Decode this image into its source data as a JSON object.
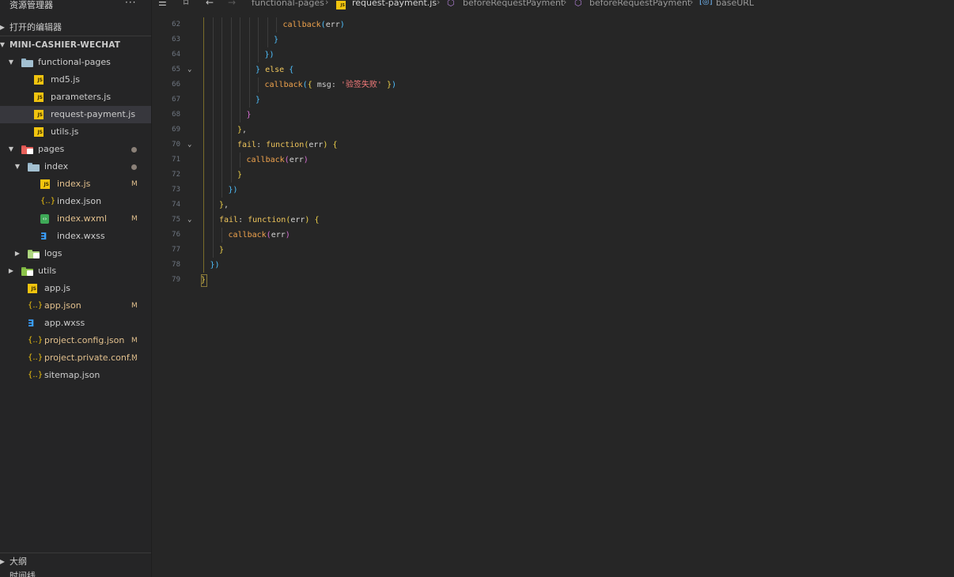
{
  "explorer": {
    "title": "资源管理器",
    "more": "···",
    "open_editors": "打开的编辑器",
    "project": "MINI-CASHIER-WECHAT",
    "outline": "大纲",
    "timeline": "时间线"
  },
  "tree": [
    {
      "label": "functional-pages",
      "type": "folder-blue",
      "indent": 0,
      "expanded": true
    },
    {
      "label": "md5.js",
      "type": "js",
      "indent": 1
    },
    {
      "label": "parameters.js",
      "type": "js",
      "indent": 1
    },
    {
      "label": "request-payment.js",
      "type": "js",
      "indent": 1,
      "selected": true
    },
    {
      "label": "utils.js",
      "type": "js",
      "indent": 1
    },
    {
      "label": "pages",
      "type": "folder-red",
      "indent": 0,
      "expanded": true,
      "dot": true
    },
    {
      "label": "index",
      "type": "folder-blue",
      "indent": 1,
      "expanded": true,
      "dot": true
    },
    {
      "label": "index.js",
      "type": "js",
      "indent": 2,
      "badge": "M"
    },
    {
      "label": "index.json",
      "type": "json",
      "indent": 2
    },
    {
      "label": "index.wxml",
      "type": "wxml",
      "indent": 2,
      "badge": "M"
    },
    {
      "label": "index.wxss",
      "type": "css",
      "indent": 2
    },
    {
      "label": "logs",
      "type": "folder-logs",
      "indent": 1,
      "expanded": false
    },
    {
      "label": "utils",
      "type": "folder-green",
      "indent": 0,
      "expanded": false
    },
    {
      "label": "app.js",
      "type": "js",
      "indent": 0
    },
    {
      "label": "app.json",
      "type": "json",
      "indent": 0,
      "badge": "M"
    },
    {
      "label": "app.wxss",
      "type": "css",
      "indent": 0
    },
    {
      "label": "project.config.json",
      "type": "json",
      "indent": 0,
      "badge": "M"
    },
    {
      "label": "project.private.conf...",
      "type": "json",
      "indent": 0,
      "badge": "M"
    },
    {
      "label": "sitemap.json",
      "type": "json",
      "indent": 0
    }
  ],
  "breadcrumb": {
    "folder": "functional-pages",
    "file": "request-payment.js",
    "fn1": "beforeRequestPayment",
    "fn2": "beforeRequestPayment",
    "prop": "baseURL",
    "js_icon_text": "JS"
  },
  "code": [
    {
      "n": "62",
      "fold": false,
      "indent": 9,
      "tokens": [
        [
          "fn",
          "callback"
        ],
        [
          "b3",
          "("
        ],
        [
          "id",
          "err"
        ],
        [
          "b3",
          ")"
        ]
      ]
    },
    {
      "n": "63",
      "fold": false,
      "indent": 8,
      "tokens": [
        [
          "b3",
          "}"
        ]
      ]
    },
    {
      "n": "64",
      "fold": false,
      "indent": 7,
      "tokens": [
        [
          "b3",
          "})"
        ]
      ]
    },
    {
      "n": "65",
      "fold": true,
      "indent": 6,
      "tokens": [
        [
          "b3",
          "}"
        ],
        [
          "p",
          " "
        ],
        [
          "kw",
          "else"
        ],
        [
          "p",
          " "
        ],
        [
          "b3",
          "{"
        ]
      ]
    },
    {
      "n": "66",
      "fold": false,
      "indent": 7,
      "tokens": [
        [
          "fn",
          "callback"
        ],
        [
          "b3",
          "("
        ],
        [
          "b1",
          "{"
        ],
        [
          "p",
          " msg: "
        ],
        [
          "str",
          "'验签失败'"
        ],
        [
          "p",
          " "
        ],
        [
          "b1",
          "}"
        ],
        [
          "b3",
          ")"
        ]
      ]
    },
    {
      "n": "67",
      "fold": false,
      "indent": 6,
      "tokens": [
        [
          "b3",
          "}"
        ]
      ]
    },
    {
      "n": "68",
      "fold": false,
      "indent": 5,
      "tokens": [
        [
          "b2",
          "}"
        ]
      ]
    },
    {
      "n": "69",
      "fold": false,
      "indent": 4,
      "tokens": [
        [
          "b1",
          "}"
        ],
        [
          "p",
          ","
        ]
      ]
    },
    {
      "n": "70",
      "fold": true,
      "indent": 4,
      "tokens": [
        [
          "kw",
          "fail"
        ],
        [
          "p",
          ": "
        ],
        [
          "kw",
          "function"
        ],
        [
          "b1",
          "("
        ],
        [
          "id",
          "err"
        ],
        [
          "b1",
          ")"
        ],
        [
          "p",
          " "
        ],
        [
          "b1",
          "{"
        ]
      ]
    },
    {
      "n": "71",
      "fold": false,
      "indent": 5,
      "tokens": [
        [
          "fn",
          "callback"
        ],
        [
          "b2",
          "("
        ],
        [
          "id",
          "err"
        ],
        [
          "b2",
          ")"
        ]
      ]
    },
    {
      "n": "72",
      "fold": false,
      "indent": 4,
      "tokens": [
        [
          "b1",
          "}"
        ]
      ]
    },
    {
      "n": "73",
      "fold": false,
      "indent": 3,
      "tokens": [
        [
          "b3",
          "})"
        ]
      ]
    },
    {
      "n": "74",
      "fold": false,
      "indent": 2,
      "tokens": [
        [
          "b1",
          "}"
        ],
        [
          "p",
          ","
        ]
      ]
    },
    {
      "n": "75",
      "fold": true,
      "indent": 2,
      "tokens": [
        [
          "kw",
          "fail"
        ],
        [
          "p",
          ": "
        ],
        [
          "kw",
          "function"
        ],
        [
          "b1",
          "("
        ],
        [
          "id",
          "err"
        ],
        [
          "b1",
          ")"
        ],
        [
          "p",
          " "
        ],
        [
          "b1",
          "{"
        ]
      ]
    },
    {
      "n": "76",
      "fold": false,
      "indent": 3,
      "tokens": [
        [
          "fn",
          "callback"
        ],
        [
          "b2",
          "("
        ],
        [
          "id",
          "err"
        ],
        [
          "b2",
          ")"
        ]
      ]
    },
    {
      "n": "77",
      "fold": false,
      "indent": 2,
      "tokens": [
        [
          "b1",
          "}"
        ]
      ]
    },
    {
      "n": "78",
      "fold": false,
      "indent": 1,
      "tokens": [
        [
          "b3",
          "})"
        ]
      ]
    },
    {
      "n": "79",
      "fold": false,
      "indent": 0,
      "tokens": [
        [
          "b1",
          "}"
        ]
      ]
    }
  ]
}
